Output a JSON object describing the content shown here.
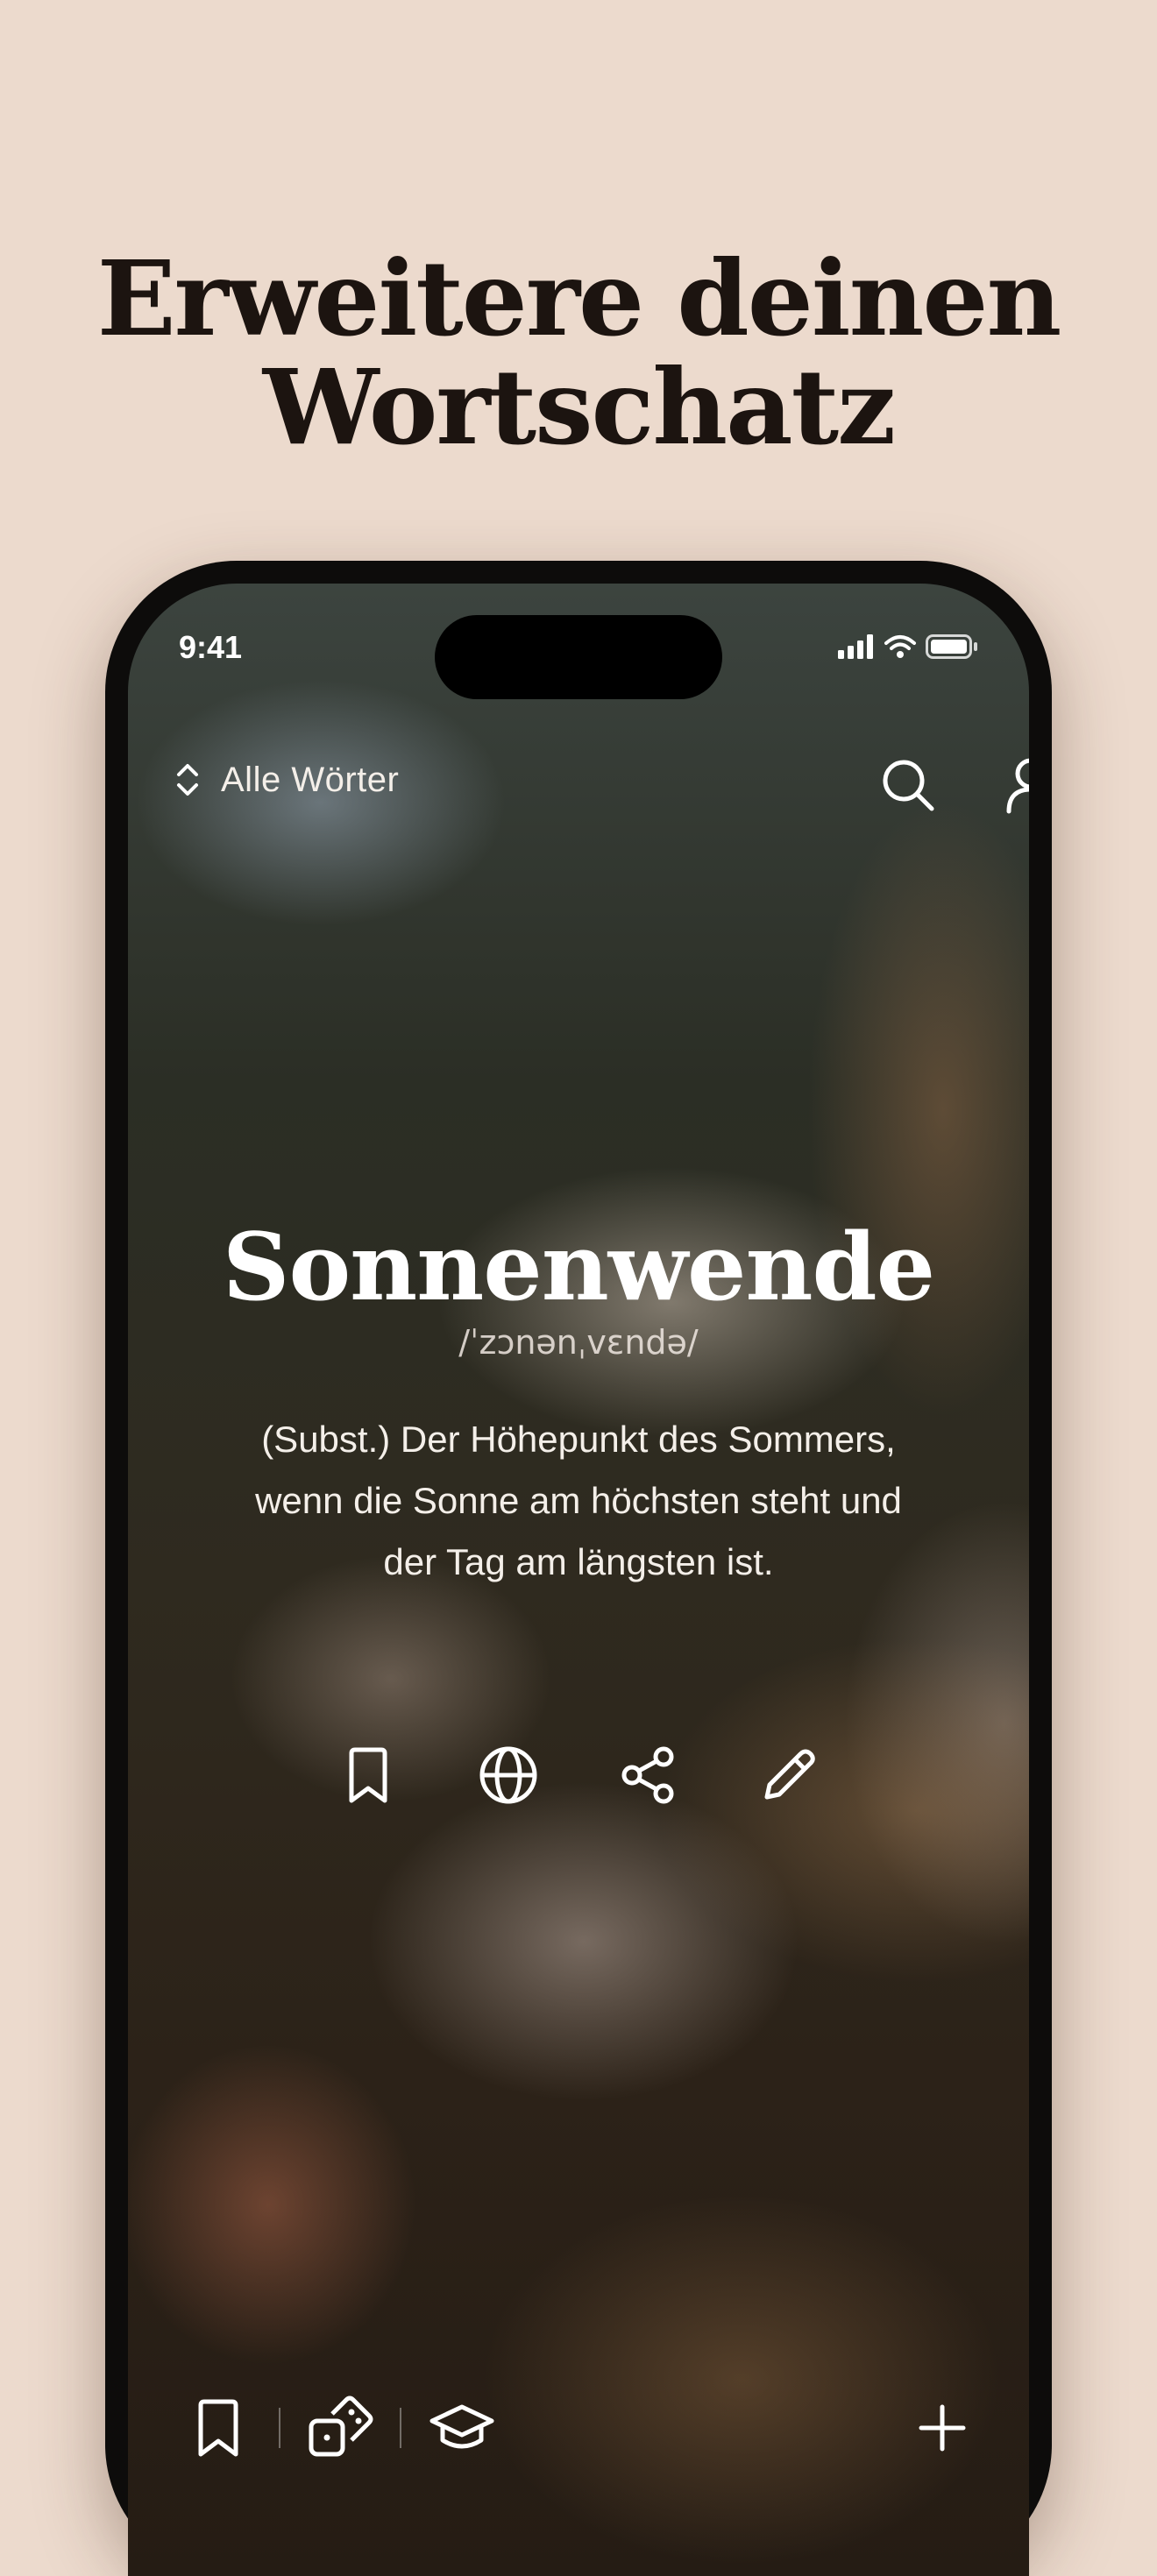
{
  "headline": {
    "line1": "Erweitere deinen",
    "line2": "Wortschatz"
  },
  "status_bar": {
    "time": "9:41",
    "icons": [
      "signal-icon",
      "wifi-icon",
      "battery-icon"
    ]
  },
  "top_bar": {
    "sort_label": "Alle Wörter",
    "sort_icon": "chevron-up-down-icon",
    "search_icon": "search-icon",
    "profile_icon": "user-icon"
  },
  "word_card": {
    "word": "Sonnenwende",
    "phonetic": "/ˈzɔnənˌvɛndə/",
    "definition": "(Subst.) Der Höhepunkt des Sommers, wenn die Sonne am höchsten steht und der Tag am längsten ist."
  },
  "actions": [
    "bookmark-icon",
    "globe-icon",
    "share-icon",
    "pencil-icon"
  ],
  "bottom_bar": {
    "left_icons": [
      "bookmark-icon",
      "dice-icon",
      "graduation-cap-icon"
    ],
    "right_icon": "plus-icon"
  },
  "colors": {
    "page_background": "#ecdacd",
    "headline": "#1c1410",
    "phone_frame": "#0d0c0b",
    "text_light": "#ffffff"
  }
}
